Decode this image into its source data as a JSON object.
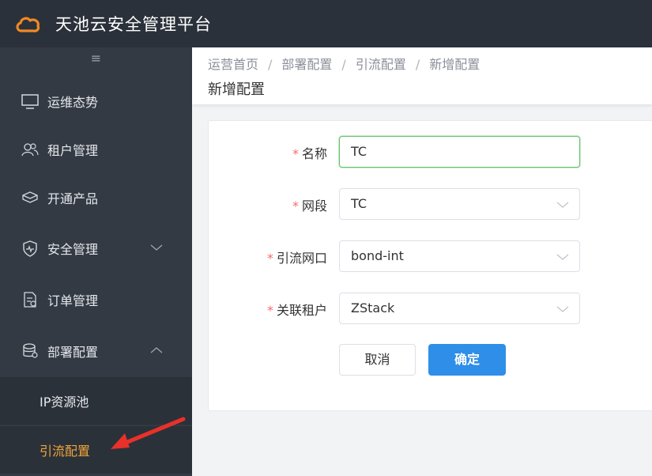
{
  "app": {
    "title": "天池云安全管理平台"
  },
  "sidebar": {
    "collapse_icon": "≡",
    "items": [
      {
        "label": "运维态势",
        "icon": "monitor-icon"
      },
      {
        "label": "租户管理",
        "icon": "users-icon"
      },
      {
        "label": "开通产品",
        "icon": "box-icon"
      },
      {
        "label": "安全管理",
        "icon": "shield-icon",
        "expanded": false
      },
      {
        "label": "订单管理",
        "icon": "order-icon"
      },
      {
        "label": "部署配置",
        "icon": "database-icon",
        "expanded": true
      }
    ],
    "sub_items": [
      {
        "label": "IP资源池",
        "active": false
      },
      {
        "label": "引流配置",
        "active": true
      }
    ]
  },
  "breadcrumb": [
    "运营首页",
    "部署配置",
    "引流配置",
    "新增配置"
  ],
  "page": {
    "title": "新增配置"
  },
  "form": {
    "fields": [
      {
        "label": "名称",
        "required": true,
        "value": "TC",
        "type": "text"
      },
      {
        "label": "网段",
        "required": true,
        "value": "TC",
        "type": "select"
      },
      {
        "label": "引流网口",
        "required": true,
        "value": "bond-int",
        "type": "select"
      },
      {
        "label": "关联租户",
        "required": true,
        "value": "ZStack",
        "type": "select"
      }
    ],
    "cancel_label": "取消",
    "ok_label": "确定"
  },
  "colors": {
    "topbar": "#2b313a",
    "sidebar": "#333a44",
    "active_text": "#f0a53a",
    "primary": "#2e8ee8",
    "required": "#f56c6c",
    "focus": "#63c46e",
    "annotation_arrow": "#e8312a",
    "logo": "#f08a24"
  }
}
